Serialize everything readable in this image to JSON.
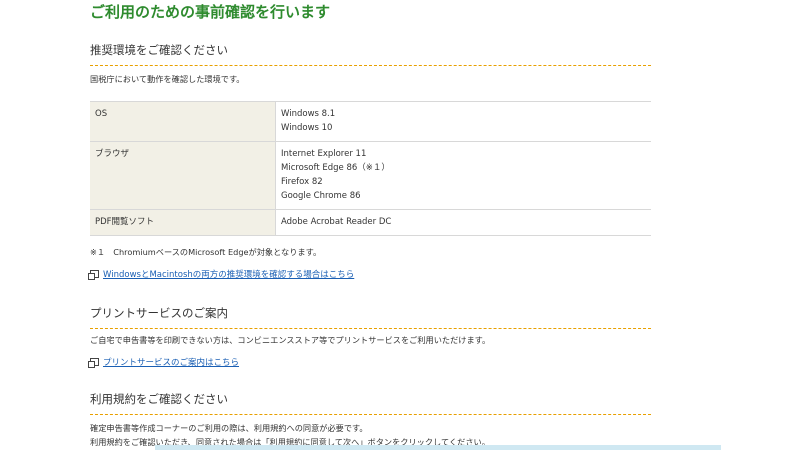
{
  "page_title": "ご利用のための事前確認を行います",
  "env_section": {
    "title": "推奨環境をご確認ください",
    "intro": "国税庁において動作を確認した環境です。",
    "rows": [
      {
        "label": "OS",
        "values": [
          "Windows 8.1",
          "Windows 10"
        ]
      },
      {
        "label": "ブラウザ",
        "values": [
          "Internet Explorer 11",
          "Microsoft Edge 86（※１）",
          "Firefox 82",
          "Google Chrome 86"
        ]
      },
      {
        "label": "PDF閲覧ソフト",
        "values": [
          "Adobe Acrobat Reader DC"
        ]
      }
    ],
    "footnote": "※１　ChromiumベースのMicrosoft Edgeが対象となります。",
    "link": "WindowsとMacintoshの両方の推奨環境を確認する場合はこちら"
  },
  "print_section": {
    "title": "プリントサービスのご案内",
    "text": "ご自宅で申告書等を印刷できない方は、コンビニエンスストア等でプリントサービスをご利用いただけます。",
    "link": "プリントサービスのご案内はこちら"
  },
  "terms_section": {
    "title": "利用規約をご確認ください",
    "line1": "確定申告書等作成コーナーのご利用の際は、利用規約への同意が必要です。",
    "line2": "利用規約をご確認いただき、同意された場合は「利用規約に同意して次へ」ボタンをクリックしてください。"
  },
  "colors": {
    "title_green": "#2e8b2e",
    "link_blue": "#1a5fb4",
    "divider_orange": "#e8a000",
    "label_bg": "#f2f0e6"
  }
}
